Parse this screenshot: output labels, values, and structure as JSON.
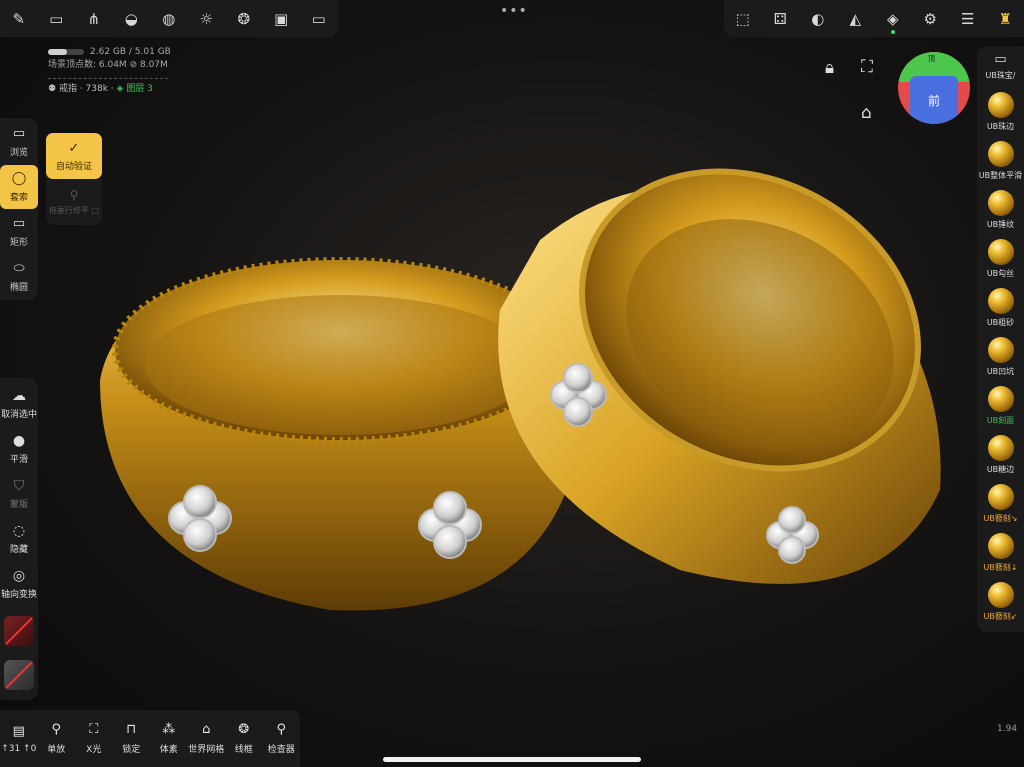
{
  "top_left_tools": [
    {
      "name": "brush-settings-icon",
      "glyph": "✎"
    },
    {
      "name": "folder-icon",
      "glyph": "▭"
    },
    {
      "name": "share-icon",
      "glyph": "⋔"
    },
    {
      "name": "material-icon",
      "glyph": "◒"
    },
    {
      "name": "globe-icon",
      "glyph": "◍"
    },
    {
      "name": "light-icon",
      "glyph": "☼"
    },
    {
      "name": "render-icon",
      "glyph": "❂"
    },
    {
      "name": "image-icon",
      "glyph": "▣"
    },
    {
      "name": "video-icon",
      "glyph": "▭"
    }
  ],
  "top_right_tools": [
    {
      "name": "select-tool-icon",
      "glyph": "⬚"
    },
    {
      "name": "random-icon",
      "glyph": "⚃"
    },
    {
      "name": "palette-icon",
      "glyph": "◐"
    },
    {
      "name": "symmetry-icon",
      "glyph": "◭"
    },
    {
      "name": "layers-icon",
      "glyph": "◈"
    },
    {
      "name": "settings-icon",
      "glyph": "⚙"
    },
    {
      "name": "sliders-icon",
      "glyph": "☰"
    },
    {
      "name": "plugin-icon",
      "glyph": "♜"
    }
  ],
  "stats": {
    "memory": "2.62 GB / 5.01 GB",
    "memory_fraction": 0.52,
    "vertices_label": "场景顶点数: 6.04M",
    "linked": "8.07M",
    "object": "戒指 · 738k ·",
    "layer": "图层 3"
  },
  "left_tools": [
    {
      "label": "浏览",
      "glyph": "▭"
    },
    {
      "label": "套索",
      "glyph": "◯"
    },
    {
      "label": "矩形",
      "glyph": "▭"
    },
    {
      "label": "椭圆",
      "glyph": "⬭"
    }
  ],
  "sub_panel": {
    "auto": "自动验证",
    "pin": "拖垂行修平 □"
  },
  "left_tools2": [
    {
      "label": "取消选中",
      "glyph": "☁"
    },
    {
      "label": "平滑",
      "glyph": "●"
    },
    {
      "label": "蒙版",
      "glyph": "⛉"
    },
    {
      "label": "隐藏",
      "glyph": "◌"
    },
    {
      "label": "轴向变换",
      "glyph": "◎"
    }
  ],
  "bottom_tools": [
    {
      "label": "↑31 ↑0",
      "glyph": "▤"
    },
    {
      "label": "单放",
      "glyph": "⚲"
    },
    {
      "label": "X光",
      "glyph": "⛶"
    },
    {
      "label": "锁定",
      "glyph": "⊓"
    },
    {
      "label": "体素",
      "glyph": "⁂"
    },
    {
      "label": "世界网格",
      "glyph": "⌂"
    },
    {
      "label": "线框",
      "glyph": "❂"
    },
    {
      "label": "检查器",
      "glyph": "⚲"
    }
  ],
  "zoom": "1.94",
  "gizmo": {
    "top": "顶",
    "front": "前"
  },
  "brush_folder": "UB珠宝/",
  "brushes": [
    {
      "label": "UB珠边",
      "state": "normal"
    },
    {
      "label": "UB整体平滑",
      "state": "normal"
    },
    {
      "label": "UB锤纹",
      "state": "normal"
    },
    {
      "label": "UB勾丝",
      "state": "normal"
    },
    {
      "label": "UB粗砂",
      "state": "normal"
    },
    {
      "label": "UB凹坑",
      "state": "normal"
    },
    {
      "label": "UB刻面",
      "state": "green"
    },
    {
      "label": "UB糖边",
      "state": "normal"
    },
    {
      "label": "UB簪刻↘",
      "state": "orange"
    },
    {
      "label": "UB簪刻↓",
      "state": "orange"
    },
    {
      "label": "UB簪刻↙",
      "state": "orange"
    }
  ],
  "colors": {
    "accent": "#f3c446",
    "green": "#3fc35a",
    "orange": "#f0a63a",
    "gold": "#d9a324"
  }
}
